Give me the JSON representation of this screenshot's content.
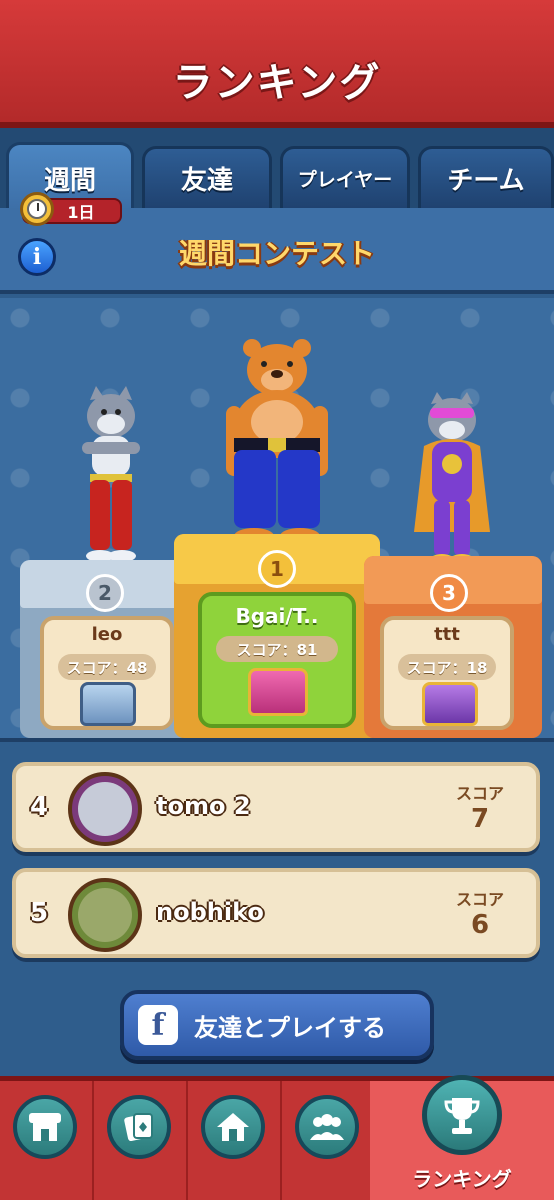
{
  "header": {
    "title": "ランキング"
  },
  "tabs": [
    {
      "label": "週間"
    },
    {
      "label": "友達"
    },
    {
      "label": "プレイヤー"
    },
    {
      "label": "チーム"
    }
  ],
  "timer": {
    "label": "1日"
  },
  "contest": {
    "info": "i",
    "title": "週間コンテスト"
  },
  "podium": [
    {
      "rank": "2",
      "name": "leo",
      "score": "スコア：48"
    },
    {
      "rank": "1",
      "name": "Bgai/T..",
      "score": "スコア：81"
    },
    {
      "rank": "3",
      "name": "ttt",
      "score": "スコア：18"
    }
  ],
  "list": [
    {
      "rank": "4",
      "name": "tomo 2",
      "score_label": "スコア",
      "score": "7"
    },
    {
      "rank": "5",
      "name": "nobhiko",
      "score_label": "スコア",
      "score": "6"
    }
  ],
  "facebook": {
    "icon": "f",
    "label": "友達とプレイする"
  },
  "nav": {
    "active_label": "ランキング"
  },
  "colors": {
    "accent_red": "#c23434",
    "gold": "#f3c03a",
    "panel_blue": "#2f5d8c"
  },
  "icons": [
    "stopwatch-icon",
    "info-icon",
    "shop-icon",
    "cards-icon",
    "home-icon",
    "team-icon",
    "trophy-icon",
    "facebook-icon",
    "treasure-chest-icon",
    "medal-icon"
  ]
}
